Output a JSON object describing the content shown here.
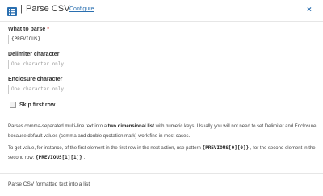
{
  "header": {
    "separator": "|",
    "title": "Parse CSV",
    "configure_label": "Configure",
    "close_glyph": "×",
    "icon": "list-icon"
  },
  "fields": {
    "what_to_parse": {
      "label": "What to parse",
      "required_mark": "*",
      "value": "{PREVIOUS}"
    },
    "delimiter": {
      "label": "Delimiter character",
      "placeholder": "One character only"
    },
    "enclosure": {
      "label": "Enclosure character",
      "placeholder": "One character only"
    }
  },
  "skip_first_row": {
    "label": "Skip first row",
    "checked": false
  },
  "description": {
    "p1_a": "Parses comma-separated multi-line text into a ",
    "p1_bold": "two dimensional list",
    "p1_b": " with numeric keys. Usually you will not need to set Delimiter and Enclosure because default values (comma and double quotation mark) work fine in most cases.",
    "p2_a": "To get value, for instance, of the first element in the first row in the next action, use pattern ",
    "p2_code1": "{PREVIOUS[0][0]}",
    "p2_b": " , for the second element in the second row: ",
    "p2_code2": "{PREVIOUS[1][1]}",
    "p2_c": " ."
  },
  "footer": {
    "text": "Parse CSV formatted text into a list"
  },
  "colors": {
    "link": "#2a6fb0",
    "required": "#d9534f",
    "border": "#c8c8c8"
  }
}
